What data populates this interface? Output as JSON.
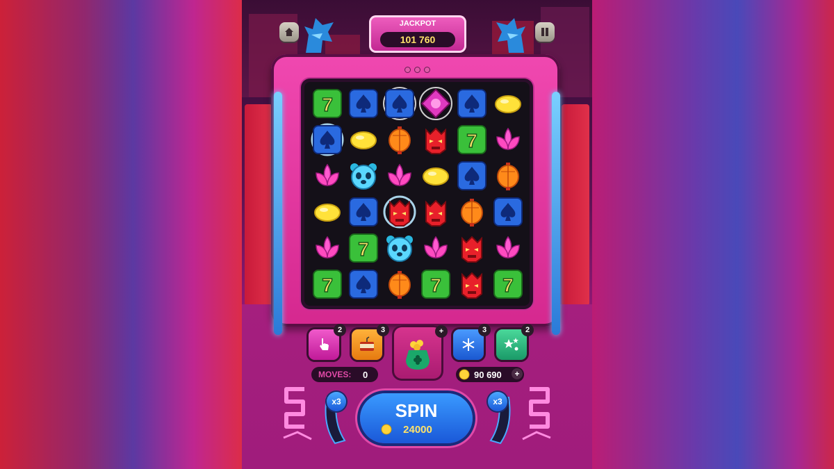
{
  "jackpot": {
    "label": "JACKPOT",
    "value": "101 760"
  },
  "top_buttons": {
    "home": "home-icon",
    "pause": "pause-icon"
  },
  "boosters": [
    {
      "name": "hand-tap",
      "icon": "hand-pointer-icon",
      "count": "2",
      "color": "#e02fb5"
    },
    {
      "name": "tnt",
      "icon": "tnt-icon",
      "count": "3",
      "color": "#ff9d1a"
    },
    {
      "name": "snowflake",
      "icon": "snowflake-icon",
      "count": "3",
      "color": "#2a7ae8"
    },
    {
      "name": "stars",
      "icon": "stars-icon",
      "count": "2",
      "color": "#2ab97a"
    }
  ],
  "lucky_pot": {
    "plus": "+",
    "icon": "money-bag-clover-icon"
  },
  "moves": {
    "label": "MOVES:",
    "value": "0"
  },
  "coins": {
    "value": "90 690",
    "plus": "+"
  },
  "spin": {
    "label": "SPIN",
    "cost": "24000"
  },
  "multipliers": {
    "left": "x3",
    "right": "x3"
  },
  "grid": [
    [
      "seven",
      "spade",
      "spade-glow",
      "diamond-glow",
      "spade",
      "lemon"
    ],
    [
      "spade-bomb",
      "lemon",
      "lantern",
      "dragon",
      "seven",
      "lotus"
    ],
    [
      "lotus",
      "panda",
      "lotus",
      "lemon",
      "spade",
      "lantern"
    ],
    [
      "lemon",
      "spade",
      "dragon-bomb",
      "dragon",
      "lantern",
      "spade"
    ],
    [
      "lotus",
      "seven",
      "panda",
      "lotus",
      "dragon",
      "lotus"
    ],
    [
      "seven",
      "spade",
      "lantern",
      "seven",
      "dragon",
      "seven"
    ]
  ],
  "colors": {
    "accent": "#e0309a",
    "gold": "#ffe36a",
    "blue": "#2a7ae8"
  }
}
